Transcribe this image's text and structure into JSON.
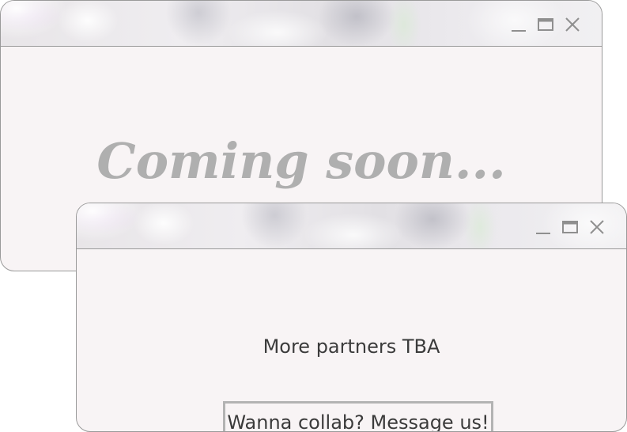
{
  "back_window": {
    "heading": "Coming soon...",
    "controls": {
      "minimize_icon": "minimize-icon",
      "maximize_icon": "maximize-icon",
      "close_icon": "close-icon"
    }
  },
  "front_window": {
    "message": "More partners TBA",
    "button_label": "Wanna collab? Message us!",
    "controls": {
      "minimize_icon": "minimize-icon",
      "maximize_icon": "maximize-icon",
      "close_icon": "close-icon"
    }
  },
  "colors": {
    "window_bg": "#f8f4f5",
    "border": "#9a9a9a",
    "heading_text": "#afafaf",
    "body_text": "#3b3b3b",
    "icon": "#8f8f8f"
  }
}
